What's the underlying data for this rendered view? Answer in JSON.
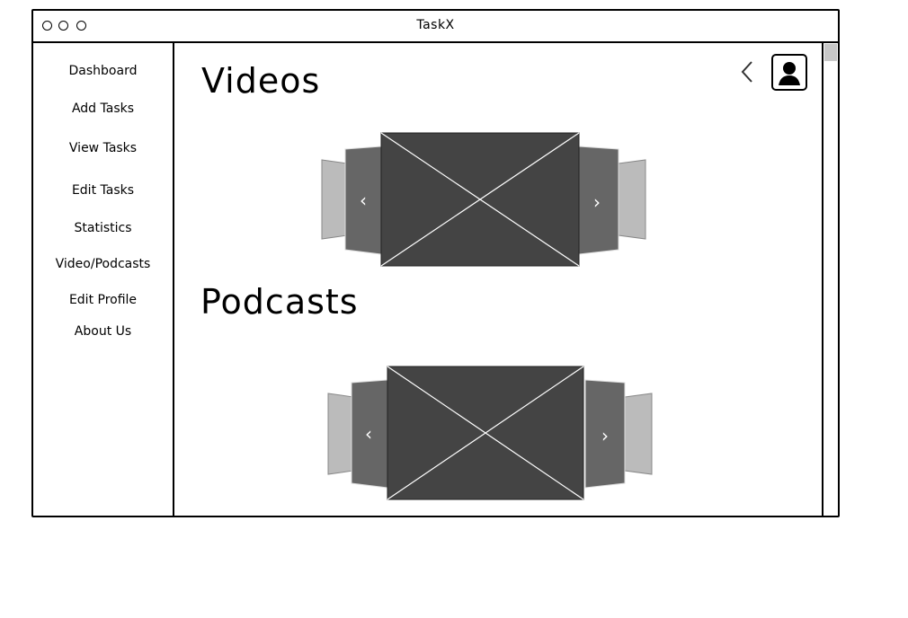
{
  "window": {
    "title": "TaskX"
  },
  "sidebar": {
    "items": [
      {
        "label": "Dashboard"
      },
      {
        "label": "Add Tasks"
      },
      {
        "label": "View Tasks"
      },
      {
        "label": "Edit Tasks"
      },
      {
        "label": "Statistics"
      },
      {
        "label": "Video/Podcasts"
      },
      {
        "label": "Edit Profile"
      },
      {
        "label": "About Us"
      }
    ]
  },
  "main": {
    "sections": [
      {
        "title": "Videos"
      },
      {
        "title": "Podcasts"
      }
    ],
    "carousel": {
      "prev_glyph": "‹",
      "next_glyph": "›"
    }
  },
  "header": {
    "back_icon": "chevron-left-icon",
    "avatar_icon": "user-avatar-icon"
  },
  "colors": {
    "image_dark": "#444444",
    "image_mid": "#666666",
    "image_light": "#bbbbbb",
    "scroll_thumb": "#c8c8c8"
  }
}
